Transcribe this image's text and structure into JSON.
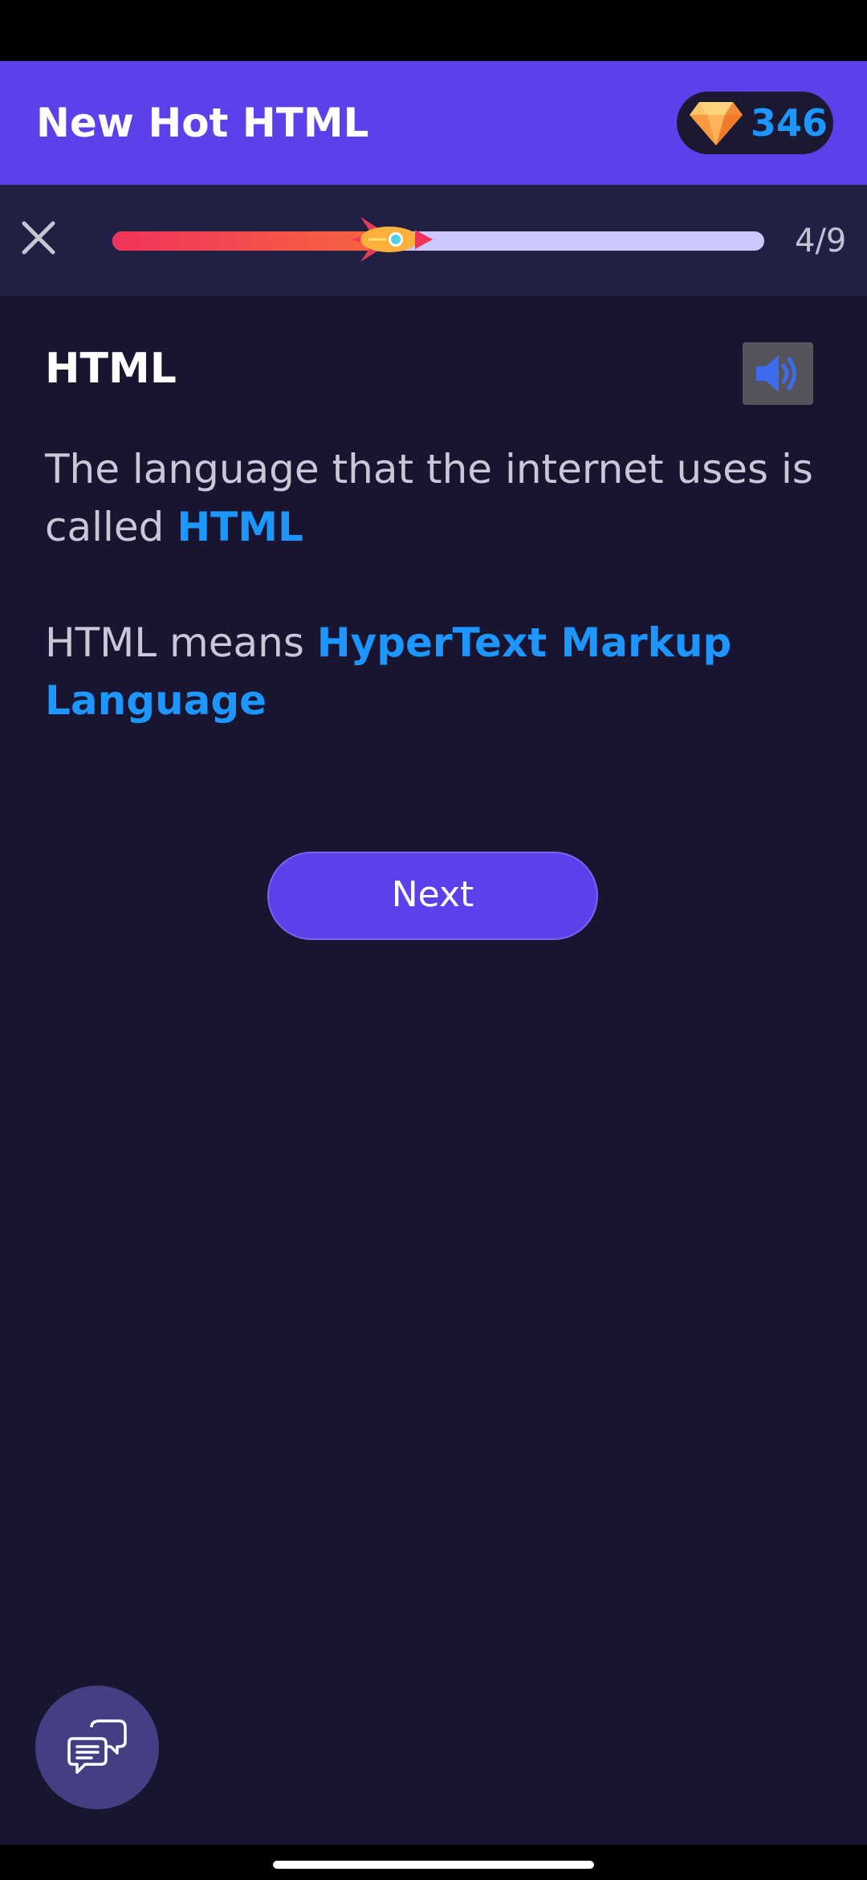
{
  "app_bar": {
    "title": "New Hot HTML",
    "gems": "346",
    "gem_icon": "diamond-icon"
  },
  "progress": {
    "label": "4/9",
    "fraction": 0.444,
    "close_icon": "close-icon",
    "marker_icon": "rocket-icon"
  },
  "lesson": {
    "title": "HTML",
    "sound_icon": "speaker-icon",
    "p1_text": "The language that the internet uses is called ",
    "p1_highlight": "HTML",
    "p2_text": "HTML means ",
    "p2_highlight": "HyperText Markup Language"
  },
  "actions": {
    "next_label": "Next",
    "chat_icon": "chat-icon"
  },
  "colors": {
    "accent": "#5e40ea",
    "background": "#17152f",
    "highlight": "#1e96ff",
    "progress_fill": "#f2325c",
    "progress_track": "#cdc8fb"
  }
}
